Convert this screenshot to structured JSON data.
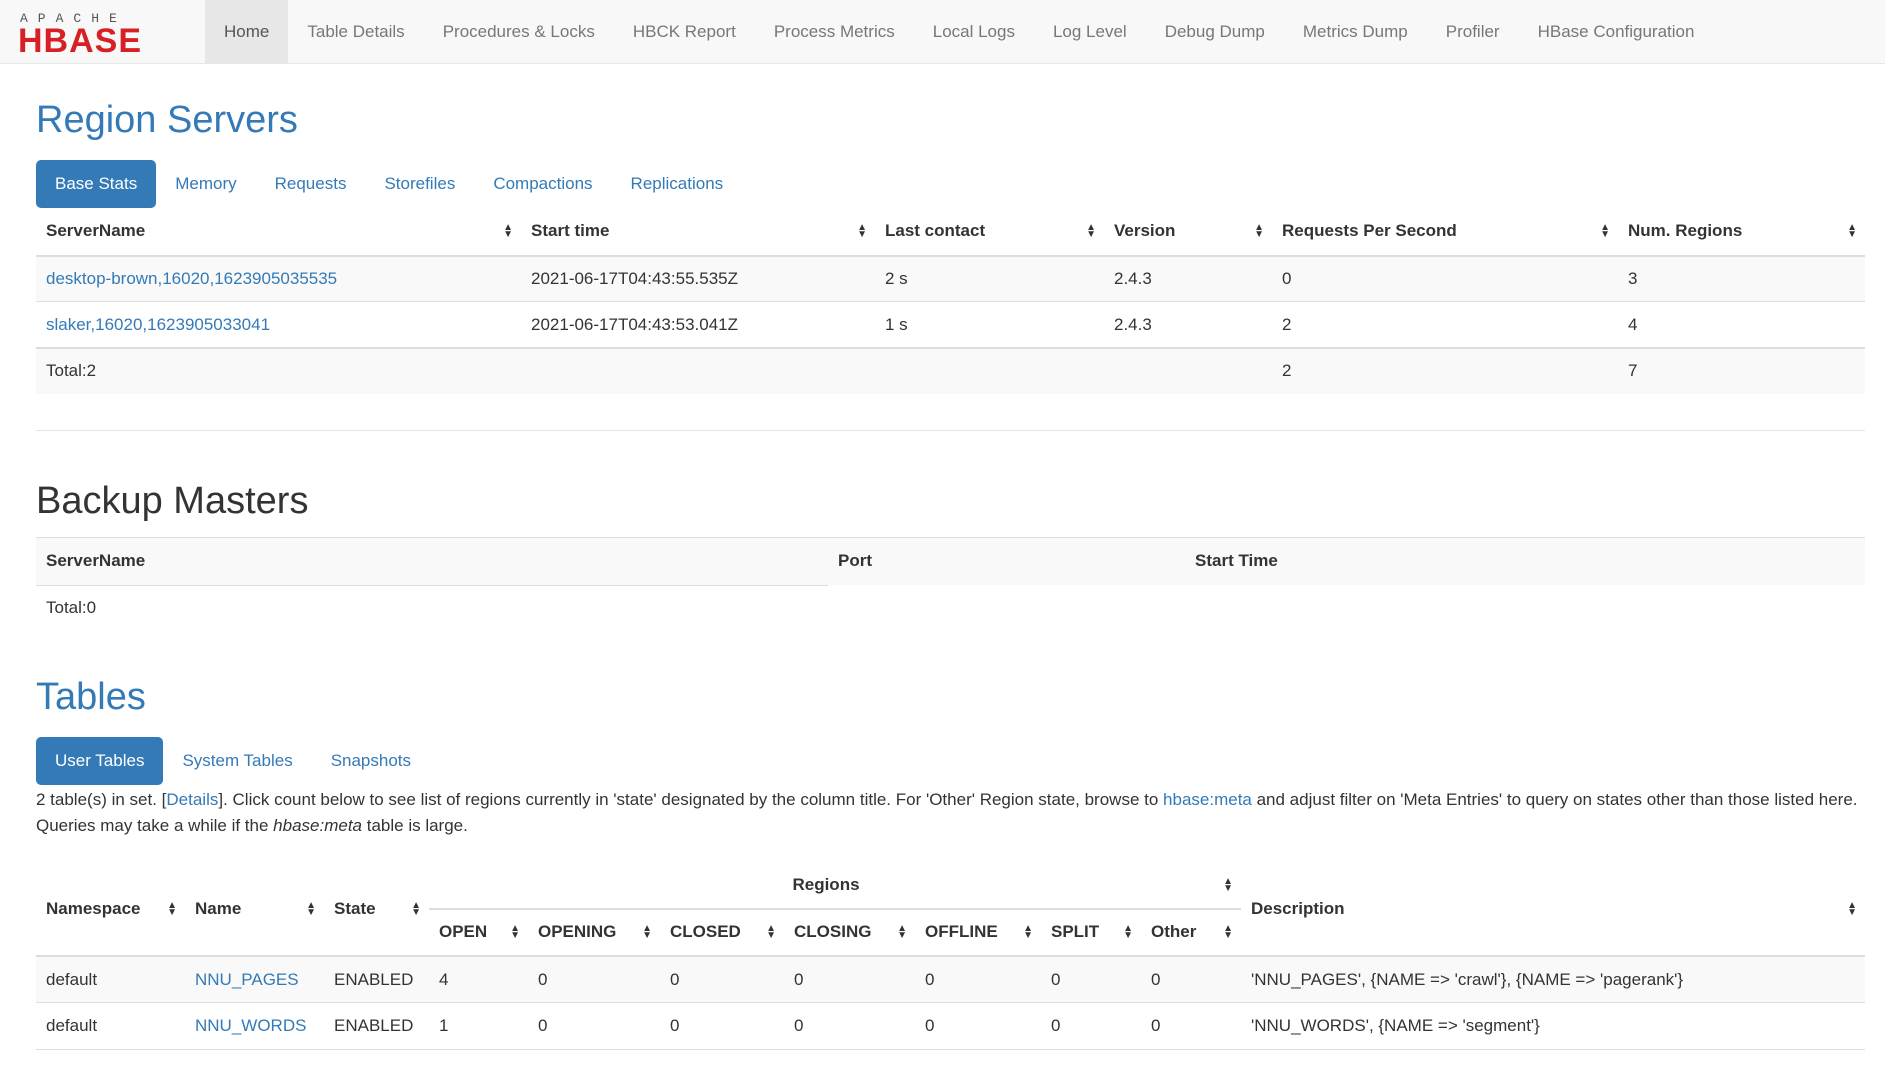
{
  "nav": {
    "logo_top": "APACHE",
    "logo_main": "HBASE",
    "items": [
      {
        "label": "Home",
        "active": true
      },
      {
        "label": "Table Details"
      },
      {
        "label": "Procedures & Locks"
      },
      {
        "label": "HBCK Report"
      },
      {
        "label": "Process Metrics"
      },
      {
        "label": "Local Logs"
      },
      {
        "label": "Log Level"
      },
      {
        "label": "Debug Dump"
      },
      {
        "label": "Metrics Dump"
      },
      {
        "label": "Profiler"
      },
      {
        "label": "HBase Configuration"
      }
    ]
  },
  "region_servers": {
    "title": "Region Servers",
    "tabs": [
      "Base Stats",
      "Memory",
      "Requests",
      "Storefiles",
      "Compactions",
      "Replications"
    ],
    "columns": [
      "ServerName",
      "Start time",
      "Last contact",
      "Version",
      "Requests Per Second",
      "Num. Regions"
    ],
    "rows": [
      [
        "desktop-brown,16020,1623905035535",
        "2021-06-17T04:43:55.535Z",
        "2 s",
        "2.4.3",
        "0",
        "3"
      ],
      [
        "slaker,16020,1623905033041",
        "2021-06-17T04:43:53.041Z",
        "1 s",
        "2.4.3",
        "2",
        "4"
      ]
    ],
    "total": {
      "label": "Total:2",
      "requests": "2",
      "regions": "7"
    }
  },
  "backup_masters": {
    "title": "Backup Masters",
    "columns": [
      "ServerName",
      "Port",
      "Start Time"
    ],
    "total": "Total:0"
  },
  "tables": {
    "title": "Tables",
    "tabs": [
      "User Tables",
      "System Tables",
      "Snapshots"
    ],
    "desc_1": "2 table(s) in set. [",
    "desc_details": "Details",
    "desc_2": "]. Click count below to see list of regions currently in 'state' designated by the column title. For 'Other' Region state, browse to ",
    "desc_meta_link": "hbase:meta",
    "desc_3": " and adjust filter on 'Meta Entries' to query on states other than those listed here. Queries may take a while if the ",
    "desc_meta_em": "hbase:meta",
    "desc_4": " table is large.",
    "columns": {
      "namespace": "Namespace",
      "name": "Name",
      "state": "State",
      "regions": "Regions",
      "description": "Description",
      "region_states": [
        "OPEN",
        "OPENING",
        "CLOSED",
        "CLOSING",
        "OFFLINE",
        "SPLIT",
        "Other"
      ]
    },
    "rows": [
      {
        "namespace": "default",
        "name": "NNU_PAGES",
        "state": "ENABLED",
        "counts": [
          "4",
          "0",
          "0",
          "0",
          "0",
          "0",
          "0"
        ],
        "description": "'NNU_PAGES', {NAME => 'crawl'}, {NAME => 'pagerank'}"
      },
      {
        "namespace": "default",
        "name": "NNU_WORDS",
        "state": "ENABLED",
        "counts": [
          "1",
          "0",
          "0",
          "0",
          "0",
          "0",
          "0"
        ],
        "description": "'NNU_WORDS', {NAME => 'segment'}"
      }
    ]
  }
}
